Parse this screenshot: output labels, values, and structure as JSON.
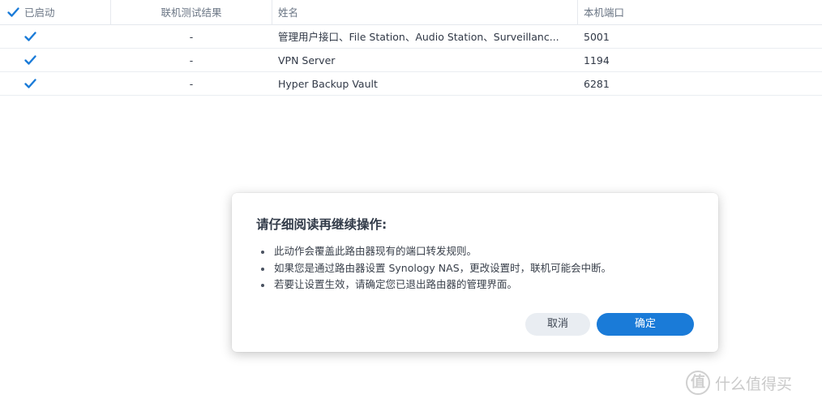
{
  "table": {
    "columns": {
      "enabled": "已启动",
      "test_result": "联机测试结果",
      "name": "姓名",
      "local_port": "本机端口"
    },
    "header_checked": true,
    "rows": [
      {
        "enabled": true,
        "test_result": "-",
        "name": "管理用户接口、File Station、Audio Station、Surveillanc...",
        "local_port": "5001"
      },
      {
        "enabled": true,
        "test_result": "-",
        "name": "VPN Server",
        "local_port": "1194"
      },
      {
        "enabled": true,
        "test_result": "-",
        "name": "Hyper Backup Vault",
        "local_port": "6281"
      }
    ]
  },
  "dialog": {
    "title": "请仔细阅读再继续操作:",
    "items": [
      "此动作会覆盖此路由器现有的端口转发规则。",
      "如果您是通过路由器设置 Synology NAS，更改设置时，联机可能会中断。",
      "若要让设置生效，请确定您已退出路由器的管理界面。"
    ],
    "cancel_label": "取消",
    "ok_label": "确定"
  },
  "watermark": {
    "logo_char": "值",
    "text": "什么值得买"
  },
  "colors": {
    "accent": "#1a7bd8",
    "checkbox": "#1a7bd8"
  }
}
